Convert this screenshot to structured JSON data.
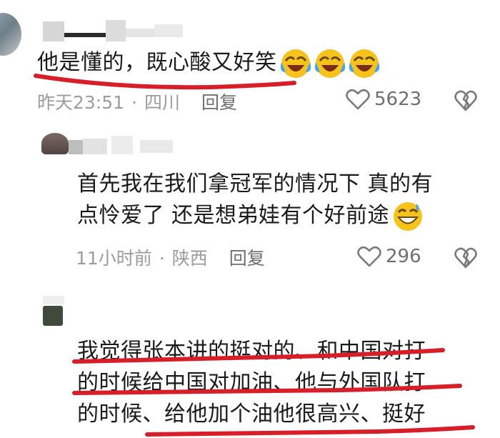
{
  "comments": [
    {
      "text": "他是懂的，既心酸又好笑",
      "emoji": [
        "face-with-tears-of-joy",
        "face-with-tears-of-joy",
        "face-with-tears-of-joy"
      ],
      "time": "昨天23:51",
      "location": "四川",
      "reply_label": "回复",
      "like_count": "5623"
    },
    {
      "text_lines": [
        "首先我在我们拿冠军的情况下 真的有",
        "点怜爱了  还是想弟娃有个好前途"
      ],
      "emoji": [
        "grinning-face-with-sweat"
      ],
      "time": "11小时前",
      "location": "陕西",
      "reply_label": "回复",
      "like_count": "296"
    },
    {
      "text_lines": [
        "我觉得张本讲的挺对的、和中国对打",
        "的时候给中国对加油、他与外国队打",
        "的时候、给他加个油他很高兴、挺好"
      ]
    }
  ],
  "separator": "·",
  "colors": {
    "underline": "#d81e28",
    "meta": "#9c9c9c",
    "text": "#1a1a1a"
  }
}
